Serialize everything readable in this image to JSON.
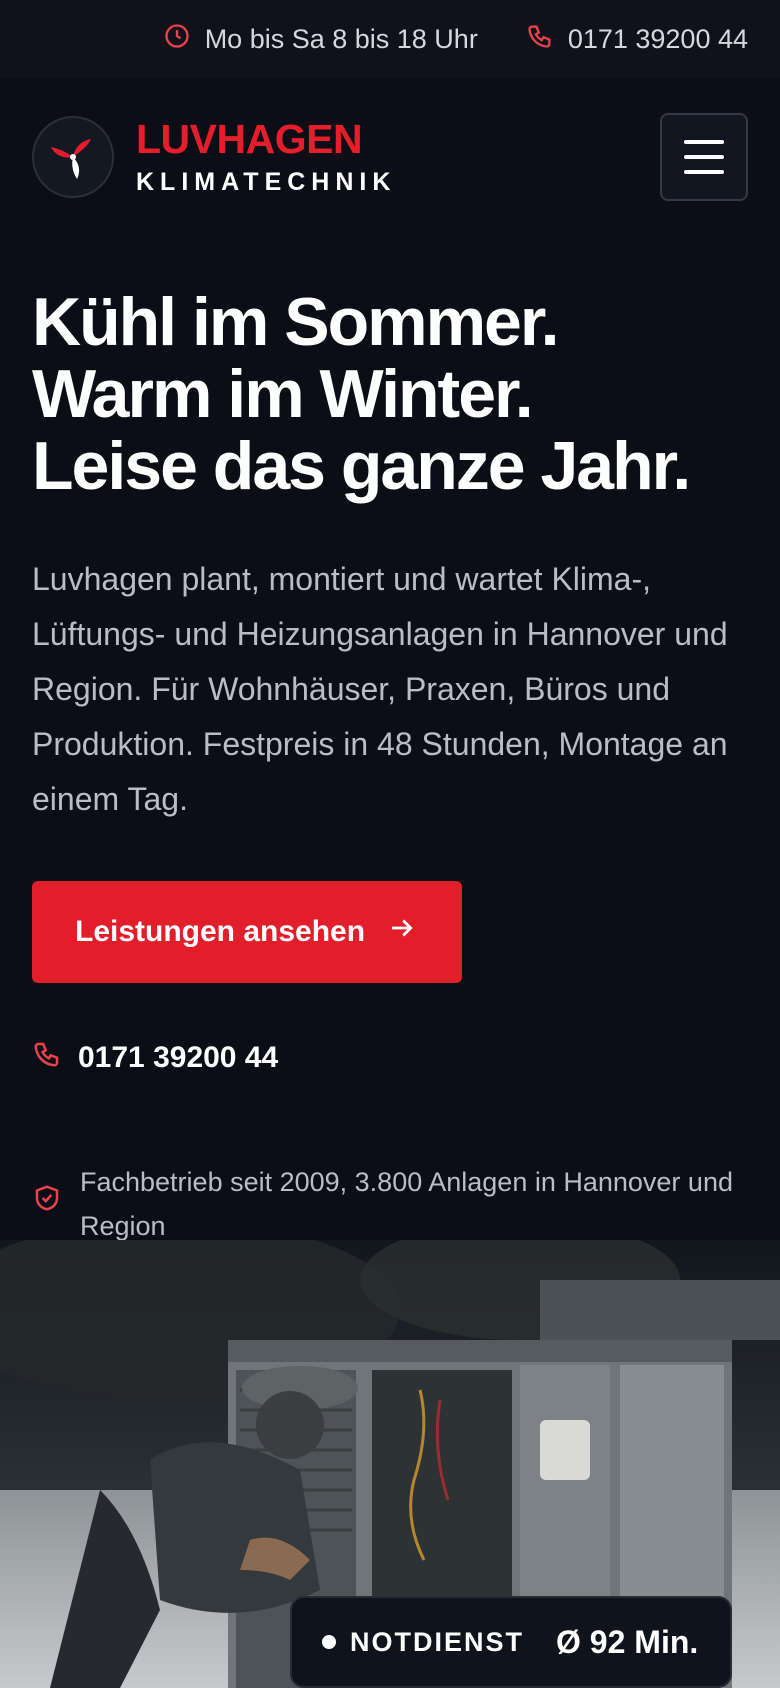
{
  "topbar": {
    "hours": "Mo bis Sa 8 bis 18 Uhr",
    "phone": "0171 39200 44"
  },
  "brand": {
    "name": "LUVHAGEN",
    "subtitle": "KLIMATECHNIK",
    "accent_color": "#e31e2b"
  },
  "hero": {
    "title_lines": [
      "Kühl im Sommer.",
      "Warm im Winter.",
      "Leise das ganze Jahr."
    ],
    "lead": "Luvhagen plant, montiert und wartet Klima-, Lüftungs- und Heizungsanlagen in Hannover und Region. Für Wohnhäuser, Praxen, Büros und Produktion. Festpreis in 48 Stunden, Montage an einem Tag.",
    "cta_label": "Leistungen ansehen",
    "phone": "0171 39200 44",
    "trust_text": "Fachbetrieb seit 2009, 3.800 Anlagen in Hannover und Region"
  },
  "badge": {
    "label": "NOTDIENST",
    "value": "Ø 92 Min."
  },
  "icons": {
    "clock": "clock-icon",
    "phone": "phone-icon",
    "menu": "hamburger-menu-icon",
    "arrow": "arrow-right-icon",
    "shield": "shield-check-icon"
  }
}
